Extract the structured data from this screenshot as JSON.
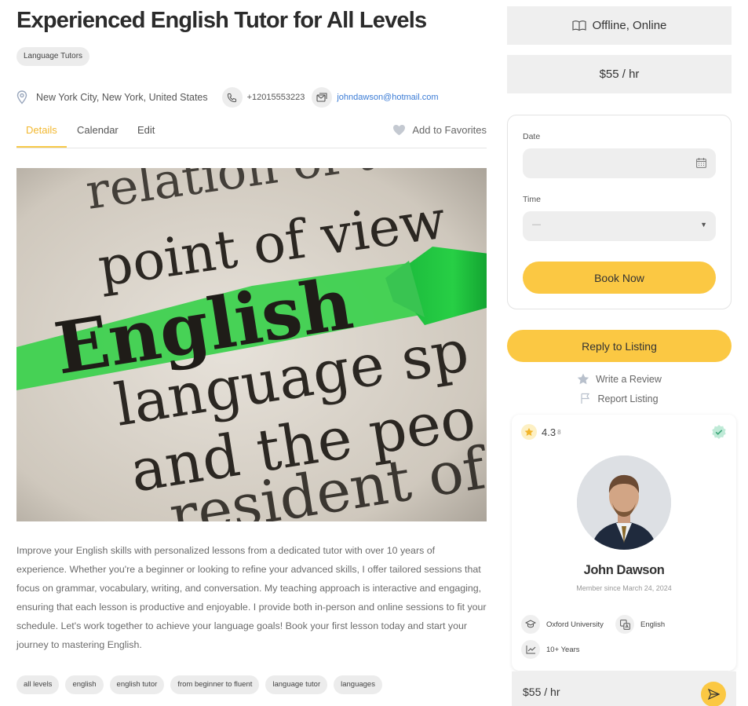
{
  "listing": {
    "title": "Experienced English Tutor for All Levels",
    "category": "Language Tutors",
    "location": "New York City, New York, United States",
    "phone": "+12015553223",
    "email": "johndawson@hotmail.com",
    "description": "Improve your English skills with personalized lessons from a dedicated tutor with over 10 years of experience. Whether you're a beginner or looking to refine your advanced skills, I offer tailored sessions that focus on grammar, vocabulary, writing, and conversation. My teaching approach is interactive and engaging, ensuring that each lesson is productive and enjoyable. I provide both in-person and online sessions to fit your schedule. Let's work together to achieve your language goals! Book your first lesson today and start your journey to mastering English.",
    "tags": [
      "all levels",
      "english",
      "english tutor",
      "from beginner to fluent",
      "language tutor",
      "languages"
    ],
    "hero_words": [
      "relation of th",
      "point of view",
      "English",
      "language sp",
      "and the peo",
      "resident of"
    ]
  },
  "tabs": {
    "details": "Details",
    "calendar": "Calendar",
    "edit": "Edit",
    "favorites": "Add to Favorites"
  },
  "sidebar": {
    "mode": "Offline, Online",
    "price": "$55 / hr",
    "booking": {
      "date_label": "Date",
      "time_label": "Time",
      "time_value": "—",
      "book_button": "Book Now"
    },
    "reply_button": "Reply to Listing",
    "write_review": "Write a Review",
    "report": "Report Listing"
  },
  "owner": {
    "rating": "4.3",
    "rating_count": "8",
    "name": "John Dawson",
    "member_since": "Member since March 24, 2024",
    "education": "Oxford University",
    "language": "English",
    "experience": "10+ Years",
    "price": "$55 / hr"
  },
  "colors": {
    "accent": "#fbc843",
    "tab_active": "#f2b830",
    "link": "#3a7bd5",
    "highlight_green": "#2ed14a"
  }
}
